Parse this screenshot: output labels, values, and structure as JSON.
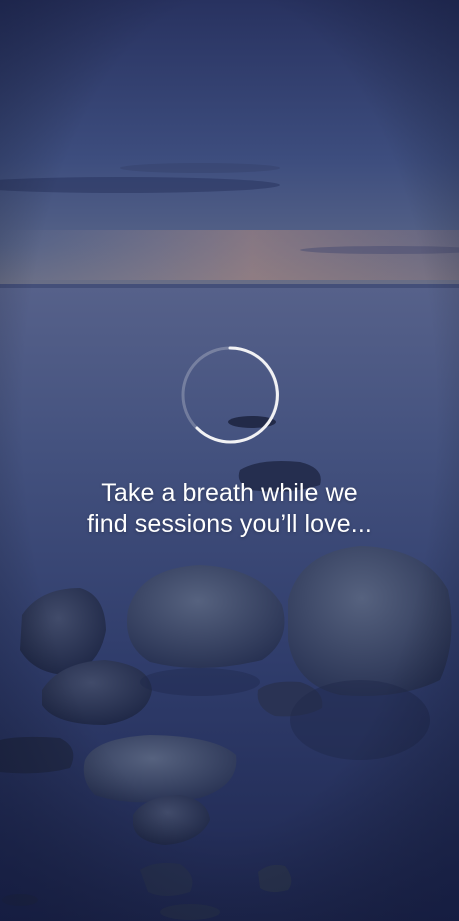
{
  "screen": {
    "message_line_1": "Take a breath while we",
    "message_line_2": "find sessions you’ll love..."
  },
  "spinner": {
    "icon": "loading-spinner-icon",
    "color": "#f2f2f4"
  },
  "background": {
    "description_icon": "calm-sea-rocks-image",
    "sky_top": "#2a3560",
    "horizon_glow": "#a8847e",
    "water": "#3a4a7d"
  }
}
